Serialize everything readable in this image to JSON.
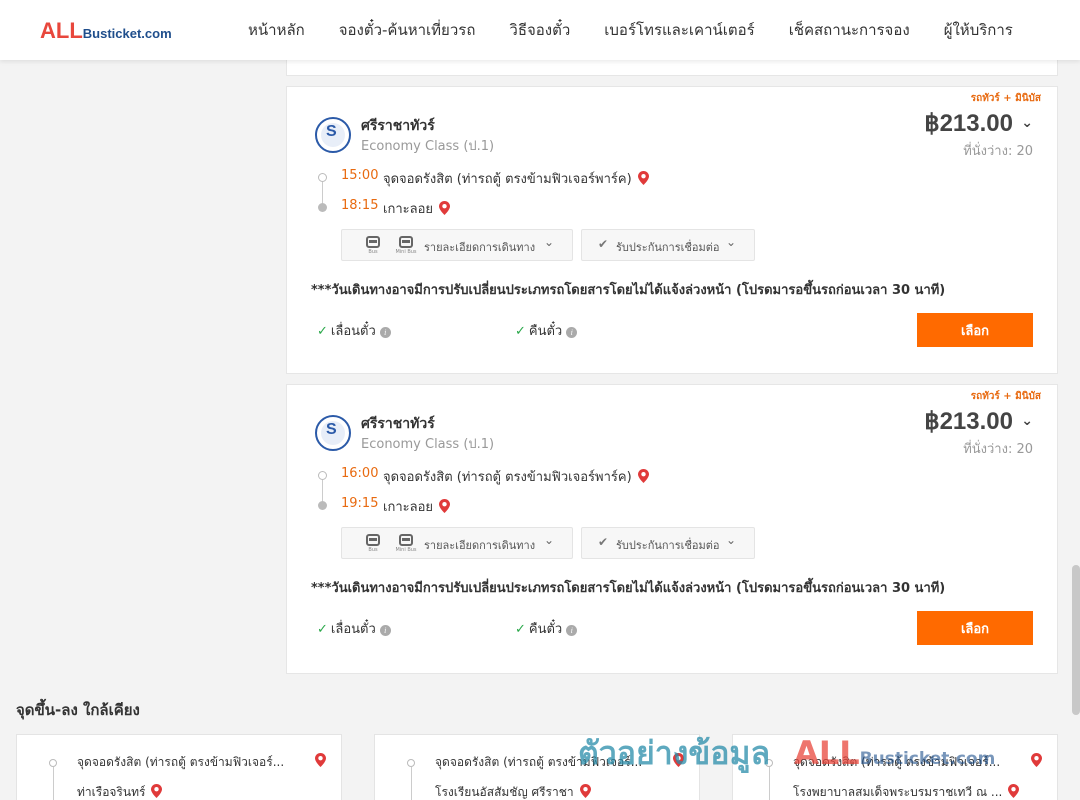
{
  "header": {
    "logo_all": "ALL",
    "logo_rest": "Busticket.com",
    "nav": [
      "หน้าหลัก",
      "จองตั๋ว-ค้นหาเที่ยวรถ",
      "วิธีจองตั๋ว",
      "เบอร์โทรและเคาน์เตอร์",
      "เช็คสถานะการจอง",
      "ผู้ให้บริการ"
    ]
  },
  "trips": [
    {
      "tag": "รถทัวร์ + มินิบัส",
      "operator": "ศรีราชาทัวร์",
      "class": "Economy Class (ป.1)",
      "price": "฿213.00",
      "seats": "ที่นั่งว่าง: 20",
      "depart_time": "15:00",
      "depart_place": "จุดจอดรังสิต (ท่ารถตู้ ตรงข้ามฟิวเจอร์พาร์ค)",
      "arrive_time": "18:15",
      "arrive_place": "เกาะลอย",
      "bus_caption": "Bus",
      "minibus_caption": "Mini Bus",
      "route_detail": "รายละเอียดการเดินทาง",
      "connection": "รับประกันการเชื่อมต่อ",
      "notice": "***วันเดินทางอาจมีการปรับเปลี่ยนประเภทรถโดยสารโดยไม่ได้แจ้งล่วงหน้า (โปรดมารอขึ้นรถก่อนเวลา 30 นาที)",
      "reschedule": "เลื่อนตั๋ว",
      "refund": "คืนตั๋ว",
      "select": "เลือก"
    },
    {
      "tag": "รถทัวร์ + มินิบัส",
      "operator": "ศรีราชาทัวร์",
      "class": "Economy Class (ป.1)",
      "price": "฿213.00",
      "seats": "ที่นั่งว่าง: 20",
      "depart_time": "16:00",
      "depart_place": "จุดจอดรังสิต (ท่ารถตู้ ตรงข้ามฟิวเจอร์พาร์ค)",
      "arrive_time": "19:15",
      "arrive_place": "เกาะลอย",
      "bus_caption": "Bus",
      "minibus_caption": "Mini Bus",
      "route_detail": "รายละเอียดการเดินทาง",
      "connection": "รับประกันการเชื่อมต่อ",
      "notice": "***วันเดินทางอาจมีการปรับเปลี่ยนประเภทรถโดยสารโดยไม่ได้แจ้งล่วงหน้า (โปรดมารอขึ้นรถก่อนเวลา 30 นาที)",
      "reschedule": "เลื่อนตั๋ว",
      "refund": "คืนตั๋ว",
      "select": "เลือก"
    }
  ],
  "nearby": {
    "title": "จุดขึ้น-ลง ใกล้เคียง",
    "cards": [
      {
        "from": "จุดจอดรังสิต (ท่ารถตู้ ตรงข้ามฟิวเจอร์...",
        "to": "ท่าเรือจรินทร์"
      },
      {
        "from": "จุดจอดรังสิต (ท่ารถตู้ ตรงข้ามฟิวเจอร์...",
        "to": "โรงเรียนอัสสัมชัญ ศรีราชา"
      },
      {
        "from": "จุดจอดรังสิต (ท่ารถตู้ ตรงข้ามฟิวเจอร์...",
        "to": "โรงพยาบาลสมเด็จพระบรมราชเทวี ณ ..."
      }
    ]
  },
  "watermark": {
    "text1": "ตัวอย่างข้อมูล",
    "text2": "ALL",
    "text3": "Busticket.com"
  },
  "colors": {
    "accent": "#ff6a00",
    "time": "#e86a10",
    "brand_red": "#e8473c",
    "brand_blue": "#1f4e8c",
    "check": "#2aa84a"
  }
}
